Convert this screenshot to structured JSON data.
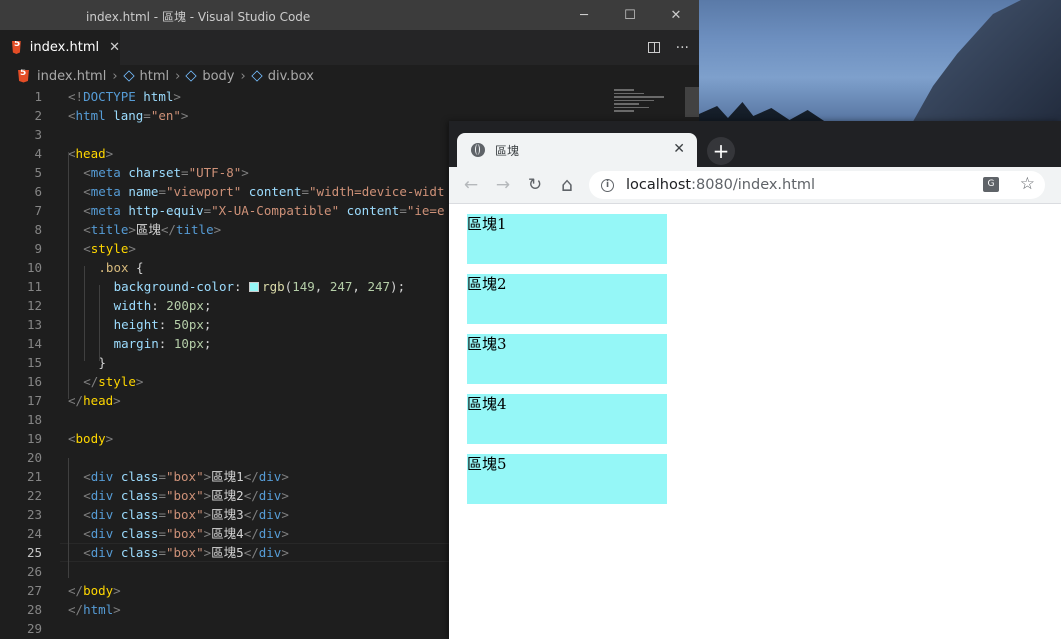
{
  "vscode": {
    "window_title": "index.html - 區塊 - Visual Studio Code",
    "controls": {
      "minimize": "─",
      "maximize": "☐",
      "close": "✕"
    },
    "tab": {
      "label": "index.html",
      "close": "✕"
    },
    "tab_actions": {
      "more": "···"
    },
    "breadcrumbs": [
      "index.html",
      "html",
      "body",
      "div.box"
    ],
    "current_line": 25,
    "lines": [
      {
        "n": "1"
      },
      {
        "n": "2"
      },
      {
        "n": "3"
      },
      {
        "n": "4"
      },
      {
        "n": "5"
      },
      {
        "n": "6"
      },
      {
        "n": "7"
      },
      {
        "n": "8"
      },
      {
        "n": "9"
      },
      {
        "n": "10"
      },
      {
        "n": "11"
      },
      {
        "n": "12"
      },
      {
        "n": "13"
      },
      {
        "n": "14"
      },
      {
        "n": "15"
      },
      {
        "n": "16"
      },
      {
        "n": "17"
      },
      {
        "n": "18"
      },
      {
        "n": "19"
      },
      {
        "n": "20"
      },
      {
        "n": "21"
      },
      {
        "n": "22"
      },
      {
        "n": "23"
      },
      {
        "n": "24"
      },
      {
        "n": "25"
      },
      {
        "n": "26"
      },
      {
        "n": "27"
      },
      {
        "n": "28"
      },
      {
        "n": "29"
      }
    ],
    "code": {
      "l1": [
        "<!",
        "DOCTYPE",
        " html",
        ">"
      ],
      "l2": [
        "<",
        "html",
        " lang",
        "=",
        "\"en\"",
        ">"
      ],
      "l4": [
        "<",
        "head",
        ">"
      ],
      "l5": [
        "<",
        "meta",
        " charset",
        "=",
        "\"UTF-8\"",
        ">"
      ],
      "l6": [
        "<",
        "meta",
        " name",
        "=",
        "\"viewport\"",
        " content",
        "=",
        "\"width=device-widt"
      ],
      "l7": [
        "<",
        "meta",
        " http-equiv",
        "=",
        "\"X-UA-Compatible\"",
        " content",
        "=",
        "\"ie=e"
      ],
      "l8": [
        "<",
        "title",
        ">",
        "區塊",
        "</",
        "title",
        ">"
      ],
      "l9": [
        "<",
        "style",
        ">"
      ],
      "l10": [
        ".box",
        " {"
      ],
      "l11": [
        "background-color",
        ": ",
        "rgb",
        "(",
        "149",
        ", ",
        "247",
        ", ",
        "247",
        ");"
      ],
      "l12": [
        "width",
        ": ",
        "200px",
        ";"
      ],
      "l13": [
        "height",
        ": ",
        "50px",
        ";"
      ],
      "l14": [
        "margin",
        ": ",
        "10px",
        ";"
      ],
      "l15": [
        "}"
      ],
      "l16": [
        "</",
        "style",
        ">"
      ],
      "l17": [
        "</",
        "head",
        ">"
      ],
      "l19": [
        "<",
        "body",
        ">"
      ],
      "l21": [
        "<",
        "div",
        " class",
        "=",
        "\"box\"",
        ">",
        "區塊1",
        "</",
        "div",
        ">"
      ],
      "l22": [
        "<",
        "div",
        " class",
        "=",
        "\"box\"",
        ">",
        "區塊2",
        "</",
        "div",
        ">"
      ],
      "l23": [
        "<",
        "div",
        " class",
        "=",
        "\"box\"",
        ">",
        "區塊3",
        "</",
        "div",
        ">"
      ],
      "l24": [
        "<",
        "div",
        " class",
        "=",
        "\"box\"",
        ">",
        "區塊4",
        "</",
        "div",
        ">"
      ],
      "l25": [
        "<",
        "div",
        " class",
        "=",
        "\"box\"",
        ">",
        "區塊5",
        "</",
        "div",
        ">"
      ],
      "l27": [
        "</",
        "body",
        ">"
      ],
      "l28": [
        "</",
        "html",
        ">"
      ]
    },
    "swatch_color": "#95f7f7"
  },
  "chrome": {
    "tab_title": "區塊",
    "tab_close": "✕",
    "new_tab": "+",
    "back": "←",
    "forward": "→",
    "reload": "↻",
    "home": "⌂",
    "url_host": "localhost",
    "url_rest": ":8080/index.html",
    "translate": "G",
    "star": "☆",
    "boxes": [
      "區塊1",
      "區塊2",
      "區塊3",
      "區塊4",
      "區塊5"
    ],
    "box_color": "rgb(149, 247, 247)"
  }
}
